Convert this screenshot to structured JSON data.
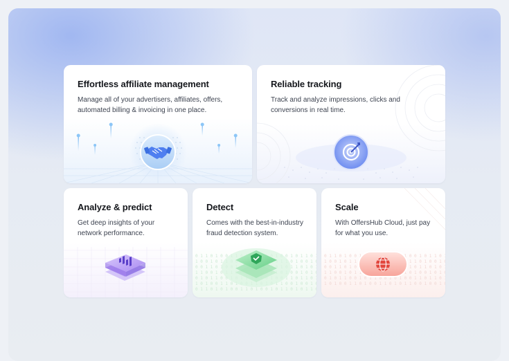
{
  "cards": [
    {
      "title": "Effortless affiliate management",
      "description": "Manage all of your advertisers, affiliates, offers,\nautomated billing & invoicing in one place.",
      "icon": "handshake-icon"
    },
    {
      "title": "Reliable tracking",
      "description": "Track and analyze impressions, clicks and\nconversions in real time.",
      "icon": "target-icon"
    },
    {
      "title": "Analyze & predict",
      "description": "Get deep insights of your\nnetwork performance.",
      "icon": "bar-chart-icon"
    },
    {
      "title": "Detect",
      "description": "Comes with the best-in-industry\nfraud detection system.",
      "icon": "shield-check-icon"
    },
    {
      "title": "Scale",
      "description": "With OffersHub Cloud, just pay\nfor what you use.",
      "icon": "globe-icon"
    }
  ],
  "colors": {
    "blue": "#4f7ff0",
    "purple": "#9b7cf0",
    "green": "#3fbf68",
    "red": "#f0645a"
  }
}
